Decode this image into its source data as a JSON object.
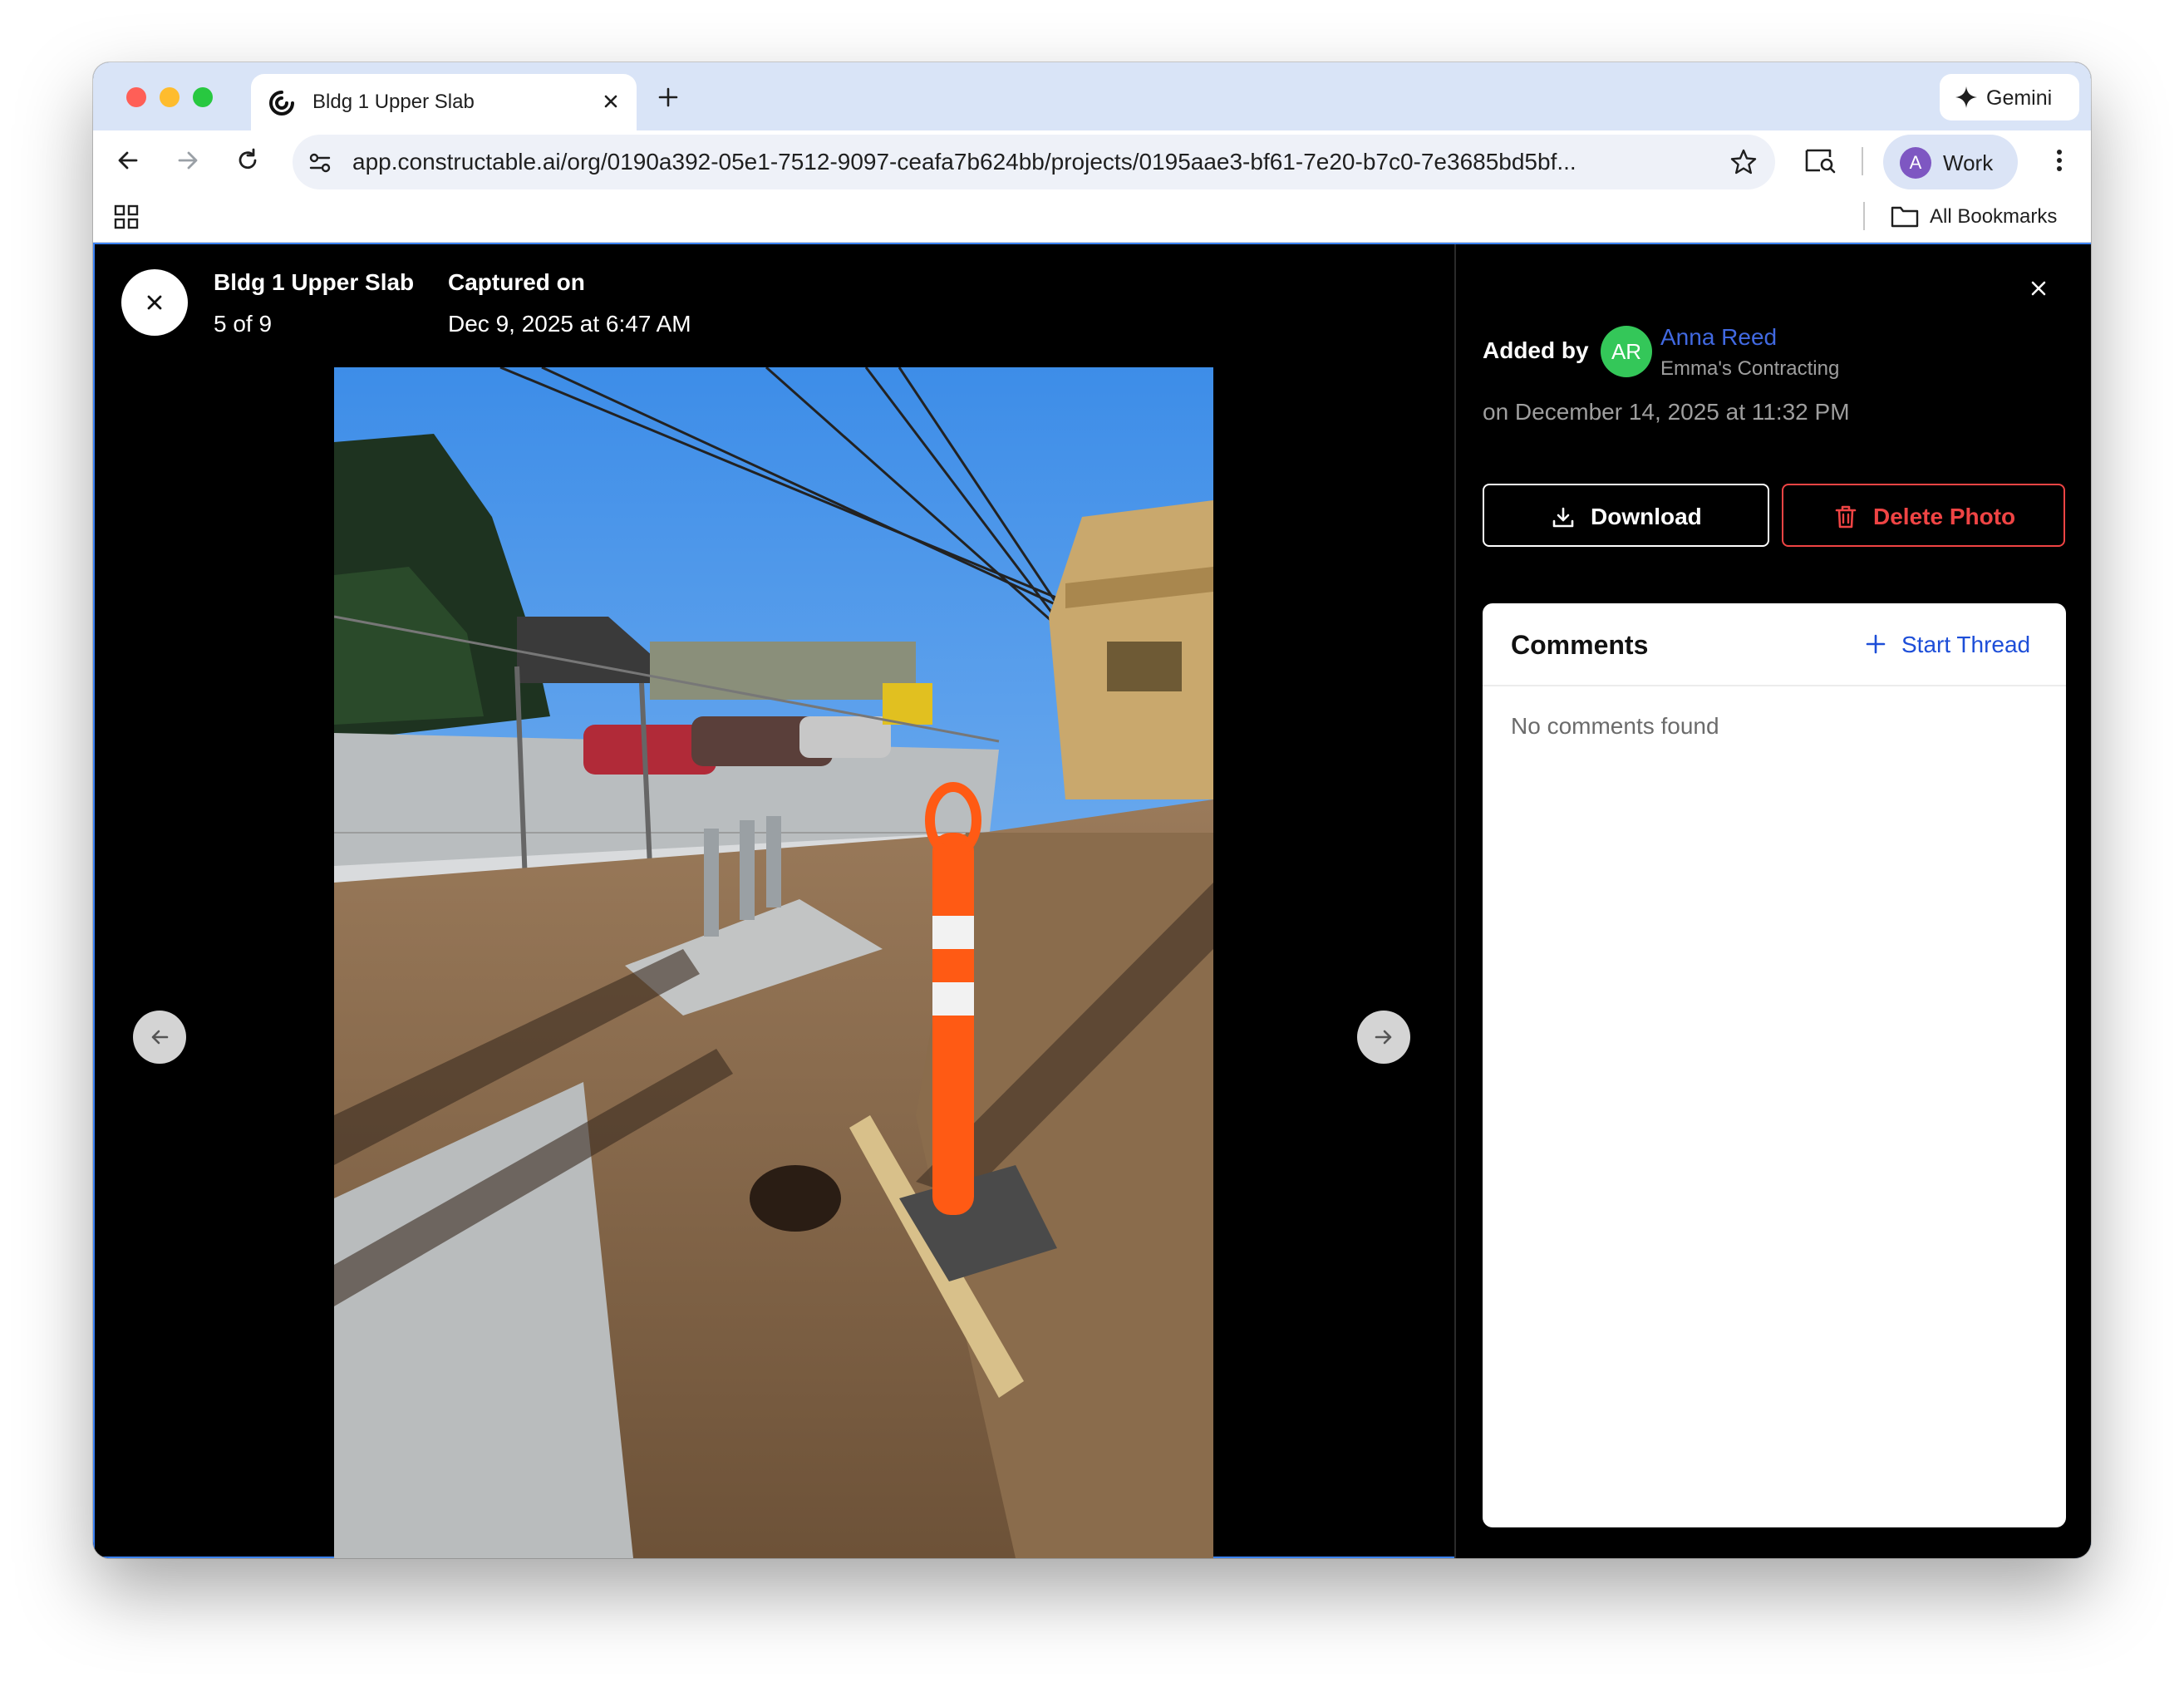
{
  "browser": {
    "tab_title": "Bldg 1 Upper Slab",
    "gemini_label": "Gemini",
    "url": "app.constructable.ai/org/0190a392-05e1-7512-9097-ceafa7b624bb/projects/0195aae3-bf61-7e20-b7c0-7e3685bd5bf...",
    "profile_initial": "A",
    "profile_label": "Work",
    "bookmarks_label": "All Bookmarks",
    "colors": {
      "tabstrip": "#d9e4f7",
      "omnibox": "#eef1f8",
      "profile_avatar": "#7e57c2"
    }
  },
  "viewer": {
    "title": "Bldg 1 Upper Slab",
    "position": "5 of 9",
    "captured_label": "Captured on",
    "captured_date": "Dec 9, 2025 at 6:47 AM",
    "photo_subject": "construction site photo: orange delineator post, wet soil, concrete slab, chain-link fence, cars, framed building"
  },
  "panel": {
    "added_by_label": "Added by",
    "avatar_initials": "AR",
    "avatar_color": "#34c759",
    "user_name": "Anna Reed",
    "company": "Emma's Contracting",
    "added_on": "on December 14, 2025 at 11:32 PM",
    "download_label": "Download",
    "delete_label": "Delete Photo",
    "comments_title": "Comments",
    "start_thread_label": "Start Thread",
    "empty_comments": "No comments found",
    "colors": {
      "link": "#4169e1",
      "danger": "#ef4444",
      "accent": "#1d4ed8"
    }
  }
}
